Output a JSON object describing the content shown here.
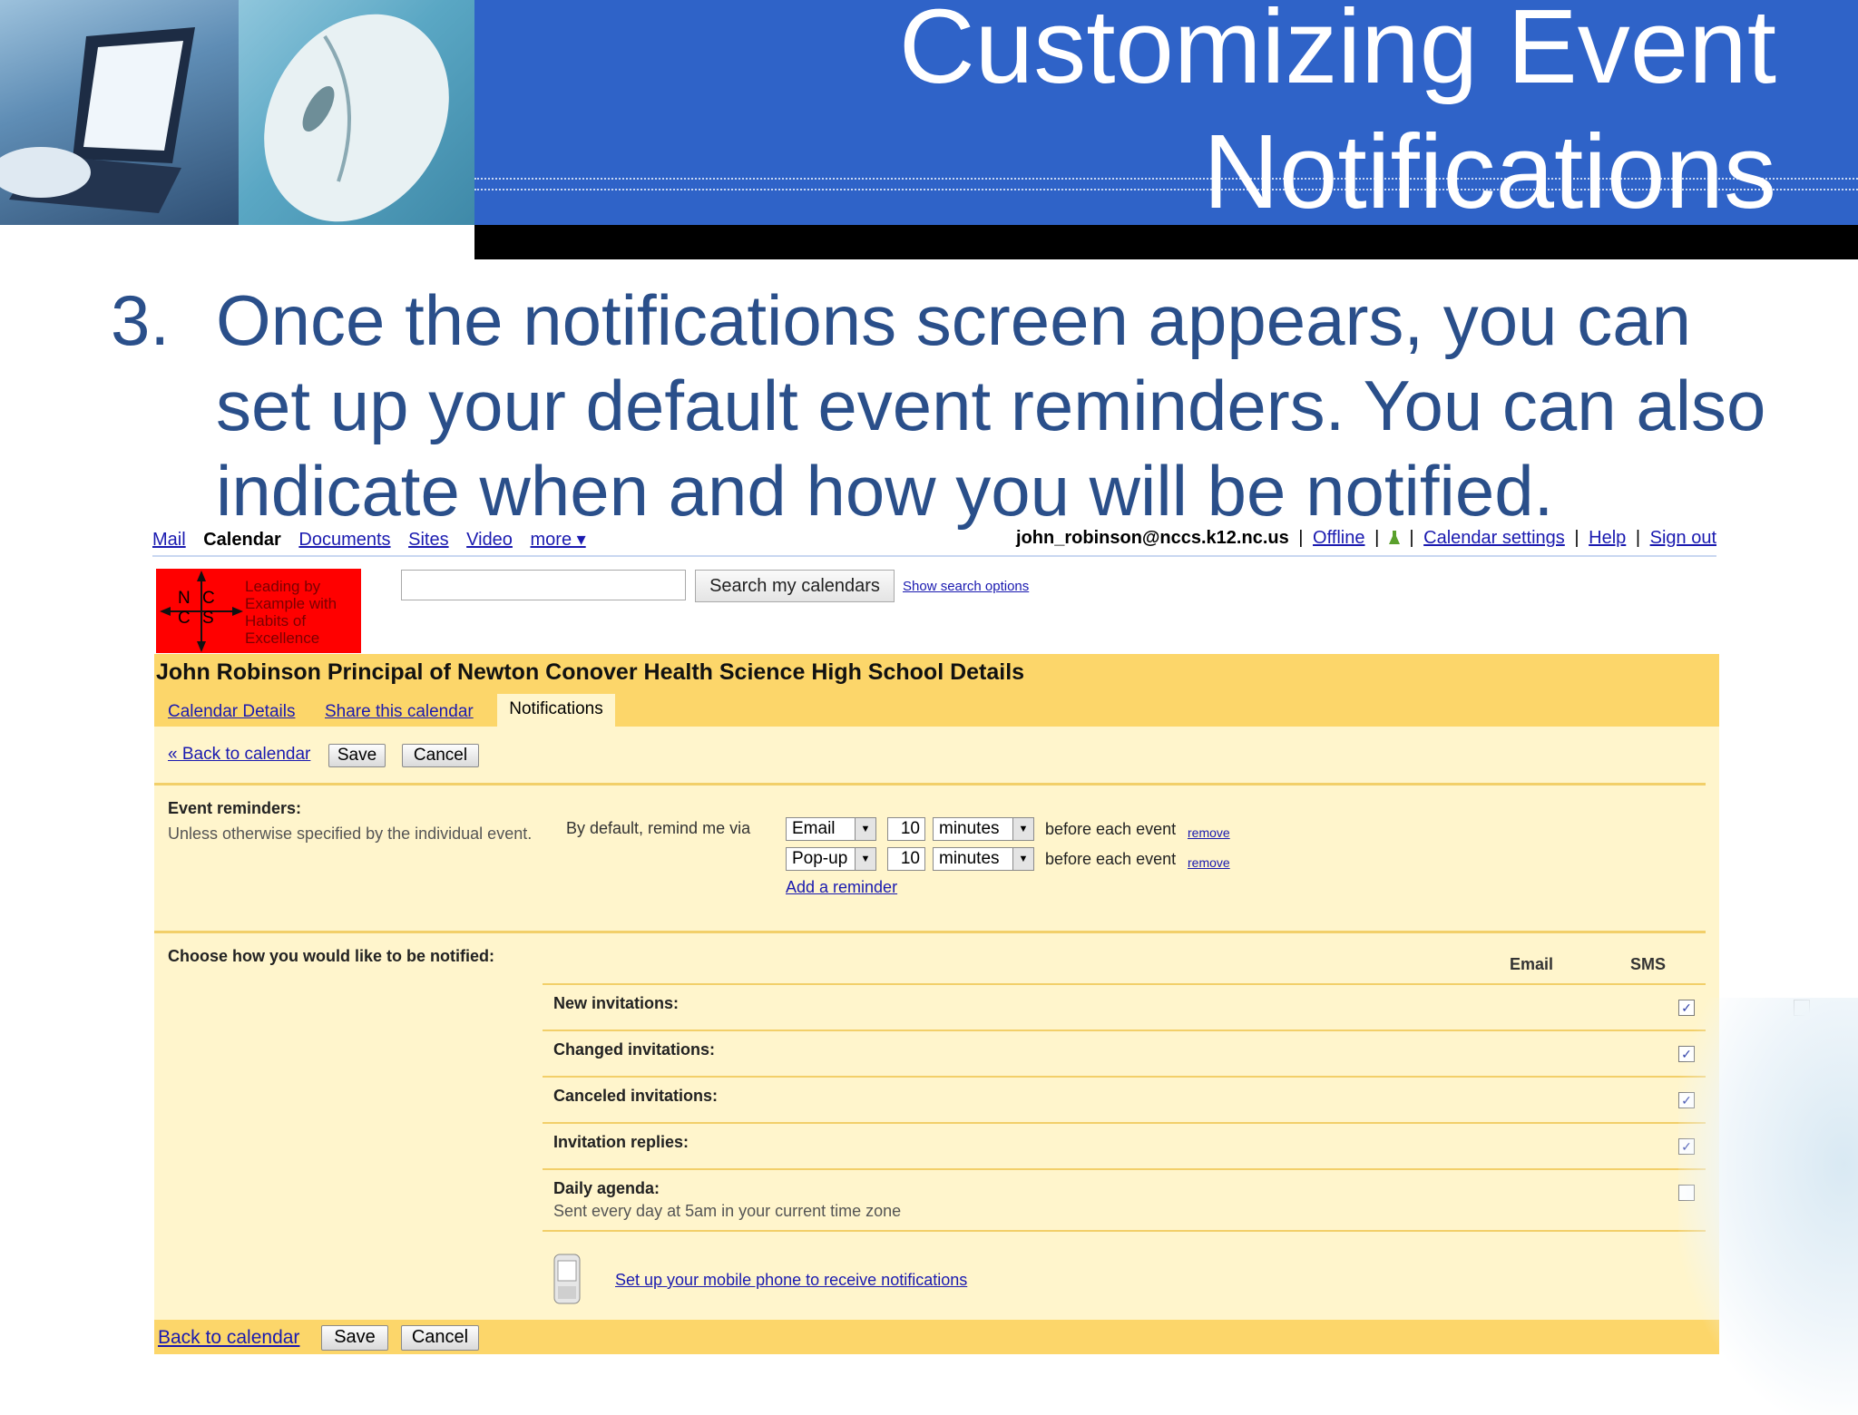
{
  "slide": {
    "title_line1": "Customizing Event",
    "title_line2": "Notifications",
    "bullet_number": "3.",
    "bullet_text": "Once the notifications screen appears, you can set up your default event reminders. You can also indicate when and how you will be notified."
  },
  "gbar": {
    "left_links": [
      "Mail",
      "Calendar",
      "Documents",
      "Sites",
      "Video",
      "more ▾"
    ],
    "user_email": "john_robinson@nccs.k12.nc.us",
    "offline": "Offline",
    "calendar_settings": "Calendar settings",
    "help": "Help",
    "sign_out": "Sign out",
    "separator": "|"
  },
  "logo": {
    "letters": "N C C S",
    "tagline": "Leading by Example with Habits of Excellence"
  },
  "search": {
    "button_label": "Search my calendars",
    "show_options": "Show search options"
  },
  "calendar": {
    "title": "John Robinson Principal of Newton Conover Health Science High School Details",
    "tabs": [
      "Calendar Details",
      "Share this calendar",
      "Notifications"
    ],
    "back_link_top": "« Back to calendar",
    "save_label": "Save",
    "cancel_label": "Cancel",
    "back_link_bottom": "Back to calendar"
  },
  "reminders": {
    "heading": "Event reminders:",
    "subtext": "Unless otherwise specified by the individual event.",
    "default_label": "By default, remind me via",
    "items": [
      {
        "method": "Email",
        "amount": "10",
        "unit": "minutes",
        "suffix": "before each event",
        "remove": "remove"
      },
      {
        "method": "Pop-up",
        "amount": "10",
        "unit": "minutes",
        "suffix": "before each event",
        "remove": "remove"
      }
    ],
    "add_link": "Add a reminder"
  },
  "notifications": {
    "heading": "Choose how you would like to be notified:",
    "col_email": "Email",
    "col_sms": "SMS",
    "rows": [
      {
        "label": "New invitations:",
        "email": true,
        "sms": false
      },
      {
        "label": "Changed invitations:",
        "email": true,
        "sms": false
      },
      {
        "label": "Canceled invitations:",
        "email": true,
        "sms": false
      },
      {
        "label": "Invitation replies:",
        "email": true,
        "sms": false
      },
      {
        "label": "Daily agenda:",
        "sublabel": "Sent every day at 5am in your current time zone",
        "email": false
      }
    ],
    "mobile_link": "Set up your mobile phone to receive notifications"
  }
}
